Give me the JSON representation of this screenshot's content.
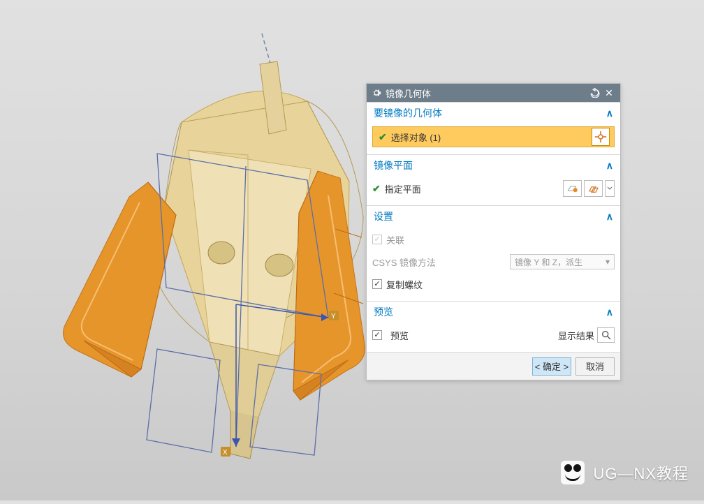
{
  "dialog": {
    "title": "镜像几何体",
    "sections": {
      "geom": {
        "header": "要镜像的几何体",
        "select_label": "选择对象 (1)"
      },
      "plane": {
        "header": "镜像平面",
        "specify_label": "指定平面"
      },
      "settings": {
        "header": "设置",
        "assoc_label": "关联",
        "csys_label": "CSYS 镜像方法",
        "csys_value": "镜像 Y 和 Z，派生",
        "copy_thread_label": "复制螺纹",
        "assoc_checked": true,
        "copy_thread_checked": true
      },
      "preview": {
        "header": "预览",
        "cb_label": "预览",
        "cb_checked": true,
        "show_result_label": "显示结果"
      }
    },
    "buttons": {
      "ok": "< 确定 >",
      "cancel": "取消"
    }
  },
  "watermark": "UG—NX教程"
}
